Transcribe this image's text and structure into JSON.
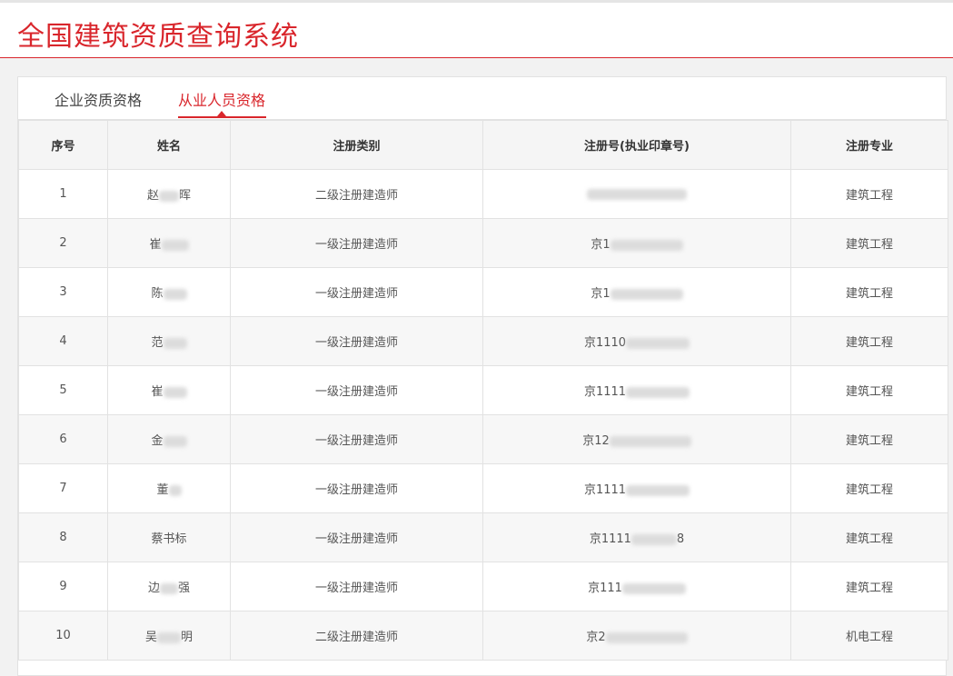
{
  "header": {
    "title": "全国建筑资质查询系统"
  },
  "tabs": [
    {
      "label": "企业资质资格"
    },
    {
      "label": "从业人员资格"
    }
  ],
  "table": {
    "columns": [
      "序号",
      "姓名",
      "注册类别",
      "注册号(执业印章号)",
      "注册专业"
    ],
    "rows": [
      {
        "no": "1",
        "name": "赵",
        "name_tail": "晖",
        "category": "二级注册建造师",
        "reg": "",
        "reg_tail": "",
        "major": "建筑工程"
      },
      {
        "no": "2",
        "name": "崔",
        "name_tail": "",
        "category": "一级注册建造师",
        "reg": "京1",
        "reg_tail": "",
        "major": "建筑工程"
      },
      {
        "no": "3",
        "name": "陈",
        "name_tail": "",
        "category": "一级注册建造师",
        "reg": "京1",
        "reg_tail": "",
        "major": "建筑工程"
      },
      {
        "no": "4",
        "name": "范",
        "name_tail": "",
        "category": "一级注册建造师",
        "reg": "京1110",
        "reg_tail": "",
        "major": "建筑工程"
      },
      {
        "no": "5",
        "name": "崔",
        "name_tail": "",
        "category": "一级注册建造师",
        "reg": "京1111",
        "reg_tail": "",
        "major": "建筑工程"
      },
      {
        "no": "6",
        "name": "金",
        "name_tail": "",
        "category": "一级注册建造师",
        "reg": "京12",
        "reg_tail": "",
        "major": "建筑工程"
      },
      {
        "no": "7",
        "name": "董",
        "name_tail": "",
        "category": "一级注册建造师",
        "reg": "京1111",
        "reg_tail": "",
        "major": "建筑工程"
      },
      {
        "no": "8",
        "name": "蔡书标",
        "name_tail": "",
        "category": "一级注册建造师",
        "reg": "京1111",
        "reg_tail": "8",
        "major": "建筑工程"
      },
      {
        "no": "9",
        "name": "边",
        "name_tail": "强",
        "category": "一级注册建造师",
        "reg": "京111",
        "reg_tail": "",
        "major": "建筑工程"
      },
      {
        "no": "10",
        "name": "吴",
        "name_tail": "明",
        "category": "二级注册建造师",
        "reg": "京2",
        "reg_tail": "",
        "major": "机电工程"
      }
    ]
  }
}
